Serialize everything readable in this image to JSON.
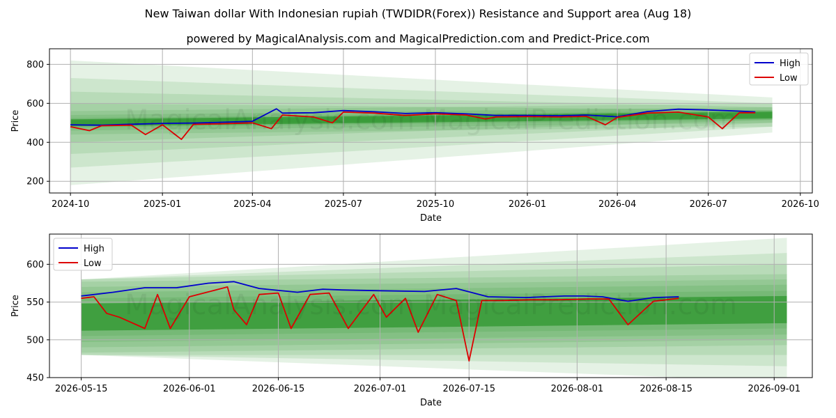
{
  "title": "New Taiwan dollar With Indonesian rupiah (TWDIDR(Forex)) Resistance and Support area (Aug 18)",
  "subtitle": "powered by MagicalAnalysis.com and MagicalPrediction.com and Predict-Price.com",
  "watermark": "MagicalAnalysis.com   MagicalPrediction.com",
  "colors": {
    "high": "#0000cc",
    "low": "#dd0000",
    "band": "#008000",
    "grid": "#b0b0b0"
  },
  "chart_data": [
    {
      "type": "line",
      "xlabel": "Date",
      "ylabel": "Price",
      "x_domain": [
        "2024-09-10",
        "2026-10-13"
      ],
      "ylim": [
        140,
        880
      ],
      "x_ticks": [
        "2024-10",
        "2025-01",
        "2025-04",
        "2025-07",
        "2025-10",
        "2026-01",
        "2026-04",
        "2026-07",
        "2026-10"
      ],
      "y_ticks": [
        200,
        400,
        600,
        800
      ],
      "legend": "top-right",
      "grid": true,
      "band_start": "2024-10-01",
      "band_end": "2026-09-03",
      "band_center": [
        500,
        540
      ],
      "band_spreads": [
        [
          60,
          60
        ],
        [
          40,
          40
        ],
        [
          25,
          25
        ],
        [
          12,
          12
        ],
        [
          320,
          90
        ],
        [
          230,
          60
        ],
        [
          160,
          40
        ],
        [
          100,
          25
        ]
      ],
      "series": [
        {
          "name": "High",
          "x": [
            "2024-10-01",
            "2024-11-01",
            "2024-12-01",
            "2025-01-01",
            "2025-02-01",
            "2025-03-01",
            "2025-04-01",
            "2025-04-25",
            "2025-05-01",
            "2025-06-01",
            "2025-07-01",
            "2025-08-01",
            "2025-09-01",
            "2025-10-01",
            "2025-11-01",
            "2025-12-01",
            "2026-01-01",
            "2026-02-01",
            "2026-03-01",
            "2026-04-01",
            "2026-05-01",
            "2026-06-01",
            "2026-07-01",
            "2026-08-01",
            "2026-08-17"
          ],
          "values": [
            490,
            488,
            493,
            497,
            499,
            503,
            508,
            572,
            550,
            552,
            563,
            557,
            548,
            552,
            546,
            538,
            538,
            536,
            540,
            531,
            558,
            570,
            566,
            560,
            556
          ]
        },
        {
          "name": "Low",
          "x": [
            "2024-10-01",
            "2024-10-20",
            "2024-11-01",
            "2024-12-01",
            "2024-12-15",
            "2025-01-01",
            "2025-01-20",
            "2025-02-01",
            "2025-03-01",
            "2025-04-01",
            "2025-04-20",
            "2025-05-01",
            "2025-06-01",
            "2025-06-20",
            "2025-07-01",
            "2025-08-01",
            "2025-09-01",
            "2025-10-01",
            "2025-11-01",
            "2025-11-20",
            "2025-12-01",
            "2026-01-01",
            "2026-02-01",
            "2026-03-01",
            "2026-03-20",
            "2026-04-01",
            "2026-05-01",
            "2026-06-01",
            "2026-07-01",
            "2026-07-15",
            "2026-08-01",
            "2026-08-17"
          ],
          "values": [
            480,
            460,
            485,
            488,
            440,
            490,
            415,
            492,
            495,
            500,
            470,
            540,
            530,
            500,
            555,
            550,
            538,
            546,
            540,
            520,
            530,
            532,
            530,
            533,
            490,
            528,
            550,
            555,
            530,
            470,
            552,
            552
          ]
        }
      ]
    },
    {
      "type": "line",
      "xlabel": "Date",
      "ylabel": "Price",
      "x_domain": [
        "2026-05-10",
        "2026-09-07"
      ],
      "ylim": [
        450,
        640
      ],
      "x_ticks": [
        "2026-05-15",
        "2026-06-01",
        "2026-06-15",
        "2026-07-01",
        "2026-07-15",
        "2026-08-01",
        "2026-08-15",
        "2026-09-01"
      ],
      "y_ticks": [
        450,
        500,
        550,
        600
      ],
      "legend": "top-left",
      "grid": true,
      "band_start": "2026-05-15",
      "band_end": "2026-09-03",
      "band_center": [
        530,
        540
      ],
      "band_spreads": [
        [
          47,
          47
        ],
        [
          40,
          40
        ],
        [
          33,
          33
        ],
        [
          25,
          25
        ],
        [
          50,
          95
        ],
        [
          50,
          75
        ],
        [
          50,
          60
        ]
      ],
      "series": [
        {
          "name": "High",
          "x": [
            "2026-05-15",
            "2026-05-20",
            "2026-05-25",
            "2026-05-30",
            "2026-06-04",
            "2026-06-08",
            "2026-06-12",
            "2026-06-18",
            "2026-06-22",
            "2026-06-25",
            "2026-07-01",
            "2026-07-08",
            "2026-07-13",
            "2026-07-18",
            "2026-07-24",
            "2026-07-30",
            "2026-08-02",
            "2026-08-05",
            "2026-08-09",
            "2026-08-13",
            "2026-08-17"
          ],
          "values": [
            558,
            563,
            569,
            569,
            575,
            577,
            568,
            563,
            567,
            566,
            565,
            564,
            568,
            557,
            556,
            558,
            558,
            557,
            551,
            556,
            557
          ]
        },
        {
          "name": "Low",
          "x": [
            "2026-05-15",
            "2026-05-17",
            "2026-05-19",
            "2026-05-21",
            "2026-05-25",
            "2026-05-27",
            "2026-05-29",
            "2026-06-01",
            "2026-06-07",
            "2026-06-08",
            "2026-06-10",
            "2026-06-12",
            "2026-06-15",
            "2026-06-17",
            "2026-06-20",
            "2026-06-23",
            "2026-06-26",
            "2026-06-30",
            "2026-07-02",
            "2026-07-05",
            "2026-07-07",
            "2026-07-10",
            "2026-07-13",
            "2026-07-15",
            "2026-07-17",
            "2026-07-20",
            "2026-07-25",
            "2026-07-29",
            "2026-08-03",
            "2026-08-06",
            "2026-08-09",
            "2026-08-13",
            "2026-08-17"
          ],
          "values": [
            555,
            557,
            535,
            530,
            515,
            560,
            515,
            557,
            570,
            540,
            520,
            560,
            562,
            515,
            560,
            562,
            515,
            560,
            530,
            555,
            510,
            560,
            552,
            472,
            552,
            552,
            553,
            553,
            554,
            554,
            520,
            551,
            555
          ]
        }
      ]
    }
  ]
}
